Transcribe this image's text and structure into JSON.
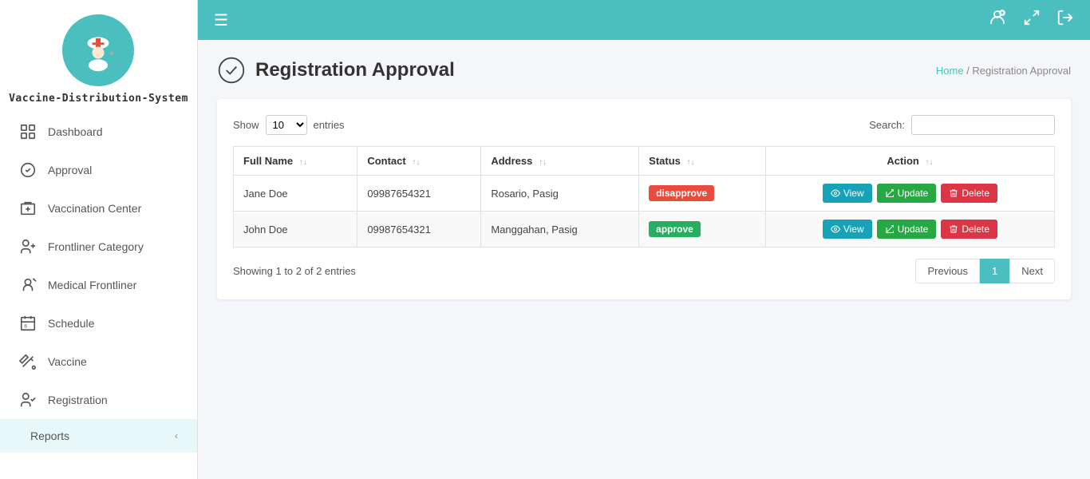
{
  "sidebar": {
    "logo_title": "Vaccine-Distribution-System",
    "nav_items": [
      {
        "id": "dashboard",
        "label": "Dashboard"
      },
      {
        "id": "approval",
        "label": "Approval"
      },
      {
        "id": "vaccination-center",
        "label": "Vaccination Center"
      },
      {
        "id": "frontliner-category",
        "label": "Frontliner Category"
      },
      {
        "id": "medical-frontliner",
        "label": "Medical Frontliner"
      },
      {
        "id": "schedule",
        "label": "Schedule"
      },
      {
        "id": "vaccine",
        "label": "Vaccine"
      },
      {
        "id": "registration",
        "label": "Registration"
      }
    ],
    "reports_label": "Reports"
  },
  "topbar": {
    "hamburger": "☰"
  },
  "breadcrumb": {
    "home": "Home",
    "current": "Registration Approval"
  },
  "page": {
    "title": "Registration Approval"
  },
  "table_controls": {
    "show_label": "Show",
    "entries_label": "entries",
    "entries_value": "10",
    "search_label": "Search:",
    "search_placeholder": ""
  },
  "table": {
    "columns": [
      "Full Name",
      "Contact",
      "Address",
      "Status",
      "Action"
    ],
    "rows": [
      {
        "full_name": "Jane Doe",
        "contact": "09987654321",
        "address": "Rosario, Pasig",
        "status": "disapprove",
        "status_type": "disapprove"
      },
      {
        "full_name": "John Doe",
        "contact": "09987654321",
        "address": "Manggahan, Pasig",
        "status": "approve",
        "status_type": "approve"
      }
    ],
    "buttons": {
      "view": "View",
      "update": "Update",
      "delete": "Delete"
    }
  },
  "pagination": {
    "showing": "Showing 1 to 2 of 2 entries",
    "previous": "Previous",
    "next": "Next",
    "current_page": "1"
  }
}
